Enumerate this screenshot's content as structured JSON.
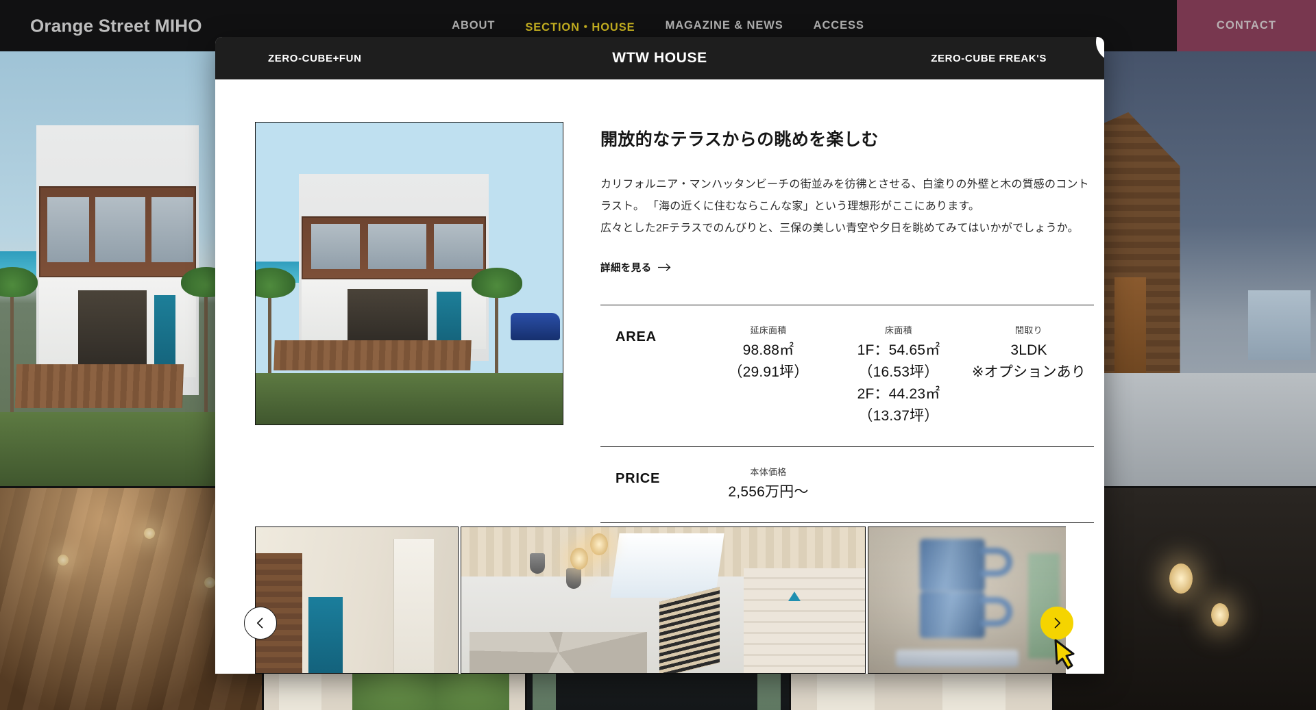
{
  "header": {
    "brand": "Orange Street MIHO",
    "nav": [
      {
        "label": "ABOUT",
        "active": false
      },
      {
        "label": "SECTION・HOUSE",
        "active": true
      },
      {
        "label": "MAGAZINE & NEWS",
        "active": false
      },
      {
        "label": "ACCESS",
        "active": false
      }
    ],
    "contact_label": "CONTACT",
    "colors": {
      "bar_bg": "#111112",
      "active_nav": "#c9b321",
      "contact_bg": "#78374f"
    }
  },
  "modal": {
    "tab_left": "ZERO-CUBE+FUN",
    "title": "WTW HOUSE",
    "tab_right": "ZERO-CUBE FREAK'S",
    "close_icon": "close-x-icon",
    "bar_bg": "#1e1e1e",
    "detail": {
      "title": "開放的なテラスからの眺めを楽しむ",
      "description": "カリフォルニア・マンハッタンビーチの街並みを彷彿とさせる、白塗りの外壁と木の質感のコントラスト。 「海の近くに住むならこんな家」という理想形がここにあります。\n広々とした2Fテラスでのんびりと、三保の美しい青空や夕日を眺めてみてはいかがでしょうか。",
      "link_label": "詳細を見る",
      "link_arrow": "arrow-right-icon"
    },
    "specs": [
      {
        "label": "AREA",
        "cells": [
          {
            "head": "延床面積",
            "value": "98.88㎡\n（29.91坪）"
          },
          {
            "head": "床面積",
            "value": "1F：54.65㎡\n（16.53坪）\n2F：44.23㎡\n（13.37坪）"
          },
          {
            "head": "間取り",
            "value": "3LDK\n※オプションあり"
          }
        ]
      },
      {
        "label": "PRICE",
        "cells": [
          {
            "head": "本体価格",
            "value": "2,556万円〜"
          },
          {
            "head": "",
            "value": ""
          },
          {
            "head": "",
            "value": ""
          }
        ]
      }
    ],
    "hero_image_alt": "white-two-story-beach-house-with-wood-deck-terrace",
    "thumbnails": [
      {
        "alt": "entry-hall-with-blue-door-and-brick-wall"
      },
      {
        "alt": "living-room-with-pendant-lights-and-open-stairs"
      },
      {
        "alt": "blue-stacked-mugs-close-up"
      }
    ],
    "carousel": {
      "prev_icon": "chevron-left-icon",
      "next_icon": "chevron-right-icon",
      "next_highlight_color": "#F5D400"
    }
  },
  "background": {
    "tiles": [
      {
        "alt": "white-beach-house-exterior"
      },
      {
        "alt": "wood-ceiling-with-downlights"
      },
      {
        "alt": "dark-wood-interior-wall"
      },
      {
        "alt": "dusk-exterior-wood-clad-house"
      },
      {
        "alt": "bright-interior-with-greenery"
      },
      {
        "alt": "dark-wood-room-with-frames"
      },
      {
        "alt": "interior-with-plants-window"
      },
      {
        "alt": "terrace-at-night"
      },
      {
        "alt": "bright-window-interior"
      },
      {
        "alt": "pendant-lamp-dark-room"
      }
    ]
  },
  "cursor": {
    "type": "hand-pointer-cursor",
    "color": "#F5D400"
  }
}
